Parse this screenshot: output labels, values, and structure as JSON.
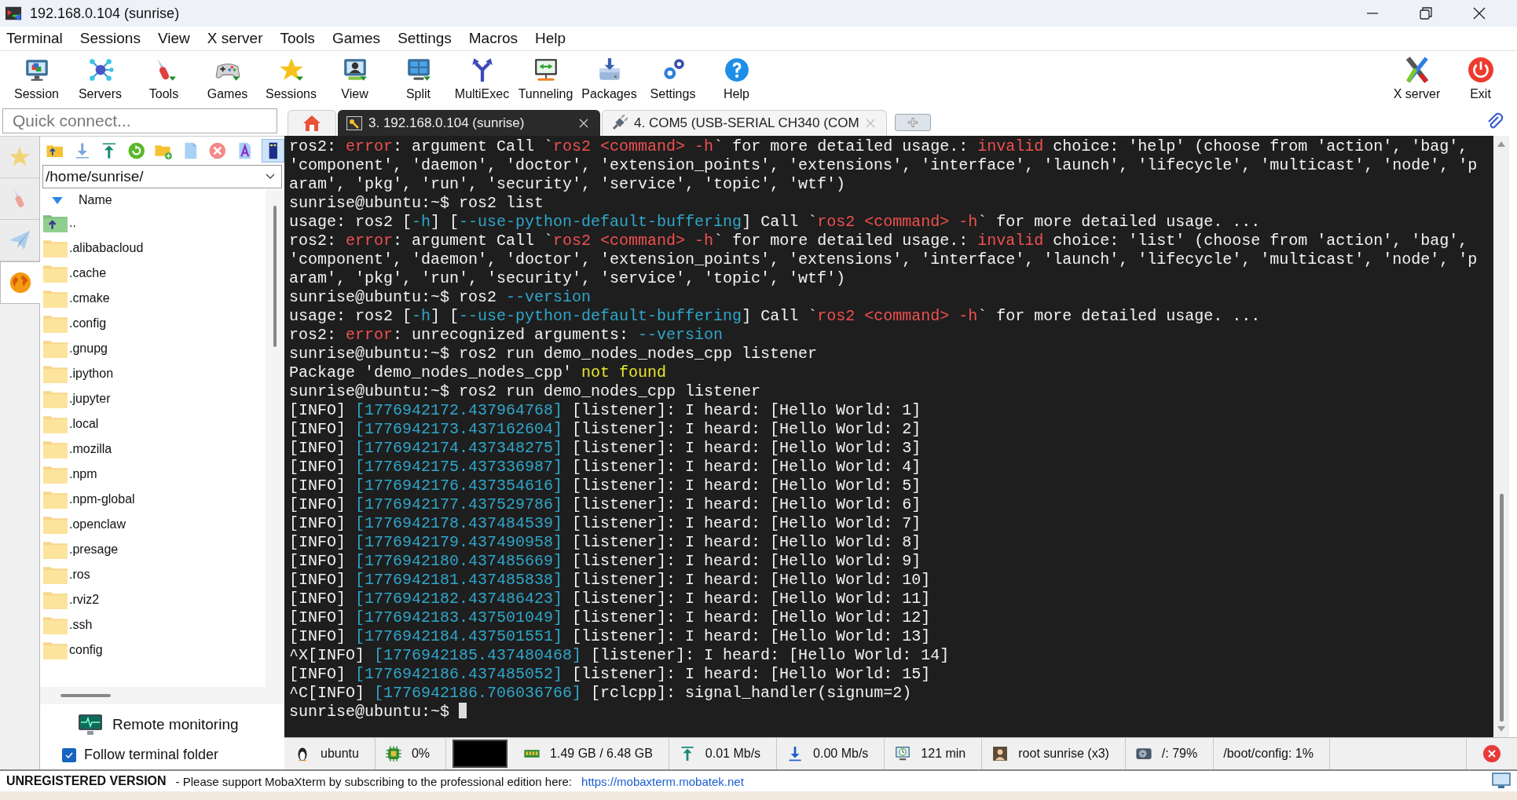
{
  "window": {
    "title": "192.168.0.104 (sunrise)"
  },
  "menu": [
    "Terminal",
    "Sessions",
    "View",
    "X server",
    "Tools",
    "Games",
    "Settings",
    "Macros",
    "Help"
  ],
  "toolbar": [
    {
      "label": "Session"
    },
    {
      "label": "Servers"
    },
    {
      "label": "Tools"
    },
    {
      "label": "Games"
    },
    {
      "label": "Sessions"
    },
    {
      "label": "View"
    },
    {
      "label": "Split"
    },
    {
      "label": "MultiExec"
    },
    {
      "label": "Tunneling"
    },
    {
      "label": "Packages"
    },
    {
      "label": "Settings"
    },
    {
      "label": "Help"
    }
  ],
  "toolbar_right": [
    {
      "label": "X server"
    },
    {
      "label": "Exit"
    }
  ],
  "quick_connect": {
    "placeholder": "Quick connect..."
  },
  "tabs": [
    {
      "label": "3. 192.168.0.104 (sunrise)",
      "selected": true
    },
    {
      "label": "4. COM5  (USB-SERIAL CH340 (COM",
      "selected": false
    }
  ],
  "sidebar_tabs": [
    {
      "selected": false
    },
    {
      "selected": false
    },
    {
      "selected": false
    },
    {
      "selected": true
    }
  ],
  "file_browser": {
    "path": "/home/sunrise/",
    "column": "Name",
    "files": [
      {
        "name": "..",
        "kind": "parent"
      },
      {
        "name": ".alibabacloud",
        "kind": "folder"
      },
      {
        "name": ".cache",
        "kind": "folder"
      },
      {
        "name": ".cmake",
        "kind": "folder"
      },
      {
        "name": ".config",
        "kind": "folder"
      },
      {
        "name": ".gnupg",
        "kind": "folder"
      },
      {
        "name": ".ipython",
        "kind": "folder"
      },
      {
        "name": ".jupyter",
        "kind": "folder"
      },
      {
        "name": ".local",
        "kind": "folder"
      },
      {
        "name": ".mozilla",
        "kind": "folder"
      },
      {
        "name": ".npm",
        "kind": "folder"
      },
      {
        "name": ".npm-global",
        "kind": "folder"
      },
      {
        "name": ".openclaw",
        "kind": "folder"
      },
      {
        "name": ".presage",
        "kind": "folder"
      },
      {
        "name": ".ros",
        "kind": "folder"
      },
      {
        "name": ".rviz2",
        "kind": "folder"
      },
      {
        "name": ".ssh",
        "kind": "folder"
      },
      {
        "name": "config",
        "kind": "folder"
      }
    ]
  },
  "remote_monitoring": "Remote monitoring",
  "follow_terminal_folder": {
    "label": "Follow terminal folder",
    "checked": true
  },
  "terminal": {
    "lines": [
      [
        {
          "text": "ros2: ",
          "kind": "plain"
        },
        {
          "text": "error",
          "kind": "error"
        },
        {
          "text": ": argument Call `",
          "kind": "plain"
        },
        {
          "text": "ros2 <command> -h",
          "kind": "error"
        },
        {
          "text": "` for more detailed usage.: ",
          "kind": "plain"
        },
        {
          "text": "invalid",
          "kind": "error"
        },
        {
          "text": " choice: 'help' (choose from 'action', 'bag',",
          "kind": "plain"
        }
      ],
      [
        {
          "text": "'component', 'daemon', 'doctor', 'extension_points', 'extensions', 'interface', 'launch', 'lifecycle', 'multicast', 'node', 'p",
          "kind": "plain"
        }
      ],
      [
        {
          "text": "aram', 'pkg', 'run', 'security', 'service', 'topic', 'wtf')",
          "kind": "plain"
        }
      ],
      [
        {
          "text": "sunrise@ubuntu:~$ ros2 list",
          "kind": "plain"
        }
      ],
      [
        {
          "text": "usage: ros2 [",
          "kind": "plain"
        },
        {
          "text": "-h",
          "kind": "option"
        },
        {
          "text": "] [",
          "kind": "plain"
        },
        {
          "text": "--use-python-default-buffering",
          "kind": "option"
        },
        {
          "text": "] Call `",
          "kind": "plain"
        },
        {
          "text": "ros2 <command> -h",
          "kind": "error"
        },
        {
          "text": "` for more detailed usage. ...",
          "kind": "plain"
        }
      ],
      [
        {
          "text": "ros2: ",
          "kind": "plain"
        },
        {
          "text": "error",
          "kind": "error"
        },
        {
          "text": ": argument Call `",
          "kind": "plain"
        },
        {
          "text": "ros2 <command> -h",
          "kind": "error"
        },
        {
          "text": "` for more detailed usage.: ",
          "kind": "plain"
        },
        {
          "text": "invalid",
          "kind": "error"
        },
        {
          "text": " choice: 'list' (choose from 'action', 'bag',",
          "kind": "plain"
        }
      ],
      [
        {
          "text": "'component', 'daemon', 'doctor', 'extension_points', 'extensions', 'interface', 'launch', 'lifecycle', 'multicast', 'node', 'p",
          "kind": "plain"
        }
      ],
      [
        {
          "text": "aram', 'pkg', 'run', 'security', 'service', 'topic', 'wtf')",
          "kind": "plain"
        }
      ],
      [
        {
          "text": "sunrise@ubuntu:~$ ros2 ",
          "kind": "plain"
        },
        {
          "text": "--version",
          "kind": "option"
        }
      ],
      [
        {
          "text": "usage: ros2 [",
          "kind": "plain"
        },
        {
          "text": "-h",
          "kind": "option"
        },
        {
          "text": "] [",
          "kind": "plain"
        },
        {
          "text": "--use-python-default-buffering",
          "kind": "option"
        },
        {
          "text": "] Call `",
          "kind": "plain"
        },
        {
          "text": "ros2 <command> -h",
          "kind": "error"
        },
        {
          "text": "` for more detailed usage. ...",
          "kind": "plain"
        }
      ],
      [
        {
          "text": "ros2: ",
          "kind": "plain"
        },
        {
          "text": "error",
          "kind": "error"
        },
        {
          "text": ": unrecognized arguments: ",
          "kind": "plain"
        },
        {
          "text": "--version",
          "kind": "option"
        }
      ],
      [
        {
          "text": "sunrise@ubuntu:~$ ros2 run demo_nodes_nodes_cpp listener",
          "kind": "plain"
        }
      ],
      [
        {
          "text": "Package 'demo_nodes_nodes_cpp' ",
          "kind": "plain"
        },
        {
          "text": "not found",
          "kind": "warning"
        }
      ],
      [
        {
          "text": "sunrise@ubuntu:~$ ros2 run demo_nodes_cpp listener",
          "kind": "plain"
        }
      ],
      [
        {
          "text": "[INFO] ",
          "kind": "plain"
        },
        {
          "text": "[1776942172.437964768]",
          "kind": "option"
        },
        {
          "text": " [listener]: I heard: [Hello World: 1]",
          "kind": "plain"
        }
      ],
      [
        {
          "text": "[INFO] ",
          "kind": "plain"
        },
        {
          "text": "[1776942173.437162604]",
          "kind": "option"
        },
        {
          "text": " [listener]: I heard: [Hello World: 2]",
          "kind": "plain"
        }
      ],
      [
        {
          "text": "[INFO] ",
          "kind": "plain"
        },
        {
          "text": "[1776942174.437348275]",
          "kind": "option"
        },
        {
          "text": " [listener]: I heard: [Hello World: 3]",
          "kind": "plain"
        }
      ],
      [
        {
          "text": "[INFO] ",
          "kind": "plain"
        },
        {
          "text": "[1776942175.437336987]",
          "kind": "option"
        },
        {
          "text": " [listener]: I heard: [Hello World: 4]",
          "kind": "plain"
        }
      ],
      [
        {
          "text": "[INFO] ",
          "kind": "plain"
        },
        {
          "text": "[1776942176.437354616]",
          "kind": "option"
        },
        {
          "text": " [listener]: I heard: [Hello World: 5]",
          "kind": "plain"
        }
      ],
      [
        {
          "text": "[INFO] ",
          "kind": "plain"
        },
        {
          "text": "[1776942177.437529786]",
          "kind": "option"
        },
        {
          "text": " [listener]: I heard: [Hello World: 6]",
          "kind": "plain"
        }
      ],
      [
        {
          "text": "[INFO] ",
          "kind": "plain"
        },
        {
          "text": "[1776942178.437484539]",
          "kind": "option"
        },
        {
          "text": " [listener]: I heard: [Hello World: 7]",
          "kind": "plain"
        }
      ],
      [
        {
          "text": "[INFO] ",
          "kind": "plain"
        },
        {
          "text": "[1776942179.437490958]",
          "kind": "option"
        },
        {
          "text": " [listener]: I heard: [Hello World: 8]",
          "kind": "plain"
        }
      ],
      [
        {
          "text": "[INFO] ",
          "kind": "plain"
        },
        {
          "text": "[1776942180.437485669]",
          "kind": "option"
        },
        {
          "text": " [listener]: I heard: [Hello World: 9]",
          "kind": "plain"
        }
      ],
      [
        {
          "text": "[INFO] ",
          "kind": "plain"
        },
        {
          "text": "[1776942181.437485838]",
          "kind": "option"
        },
        {
          "text": " [listener]: I heard: [Hello World: 10]",
          "kind": "plain"
        }
      ],
      [
        {
          "text": "[INFO] ",
          "kind": "plain"
        },
        {
          "text": "[1776942182.437486423]",
          "kind": "option"
        },
        {
          "text": " [listener]: I heard: [Hello World: 11]",
          "kind": "plain"
        }
      ],
      [
        {
          "text": "[INFO] ",
          "kind": "plain"
        },
        {
          "text": "[1776942183.437501049]",
          "kind": "option"
        },
        {
          "text": " [listener]: I heard: [Hello World: 12]",
          "kind": "plain"
        }
      ],
      [
        {
          "text": "[INFO] ",
          "kind": "plain"
        },
        {
          "text": "[1776942184.437501551]",
          "kind": "option"
        },
        {
          "text": " [listener]: I heard: [Hello World: 13]",
          "kind": "plain"
        }
      ],
      [
        {
          "text": "^X[INFO] ",
          "kind": "plain"
        },
        {
          "text": "[1776942185.437480468]",
          "kind": "option"
        },
        {
          "text": " [listener]: I heard: [Hello World: 14]",
          "kind": "plain"
        }
      ],
      [
        {
          "text": "[INFO] ",
          "kind": "plain"
        },
        {
          "text": "[1776942186.437485052]",
          "kind": "option"
        },
        {
          "text": " [listener]: I heard: [Hello World: 15]",
          "kind": "plain"
        }
      ],
      [
        {
          "text": "^C[INFO] ",
          "kind": "plain"
        },
        {
          "text": "[1776942186.706036766]",
          "kind": "option"
        },
        {
          "text": " [rclcpp]: signal_handler(signum=2)",
          "kind": "plain"
        }
      ],
      [
        {
          "text": "sunrise@ubuntu:~$ ",
          "kind": "plain"
        }
      ]
    ]
  },
  "status_bar": [
    {
      "kind": "reading",
      "text": "ubuntu"
    },
    {
      "kind": "reading",
      "text": "0%"
    },
    {
      "kind": "graph"
    },
    {
      "kind": "reading",
      "text": "1.49 GB / 6.48 GB"
    },
    {
      "kind": "reading",
      "text": "0.01 Mb/s"
    },
    {
      "kind": "reading",
      "text": "0.00 Mb/s"
    },
    {
      "kind": "reading",
      "text": "121 min"
    },
    {
      "kind": "reading",
      "text": "root  sunrise (x3)"
    },
    {
      "kind": "reading",
      "text": "/: 79%"
    },
    {
      "kind": "reading",
      "text": "/boot/config: 1%"
    }
  ],
  "footer": {
    "notice": "UNREGISTERED VERSION",
    "message": "-  Please support MobaXterm by subscribing to the professional edition here:",
    "link": "https://mobaxterm.mobatek.net"
  }
}
